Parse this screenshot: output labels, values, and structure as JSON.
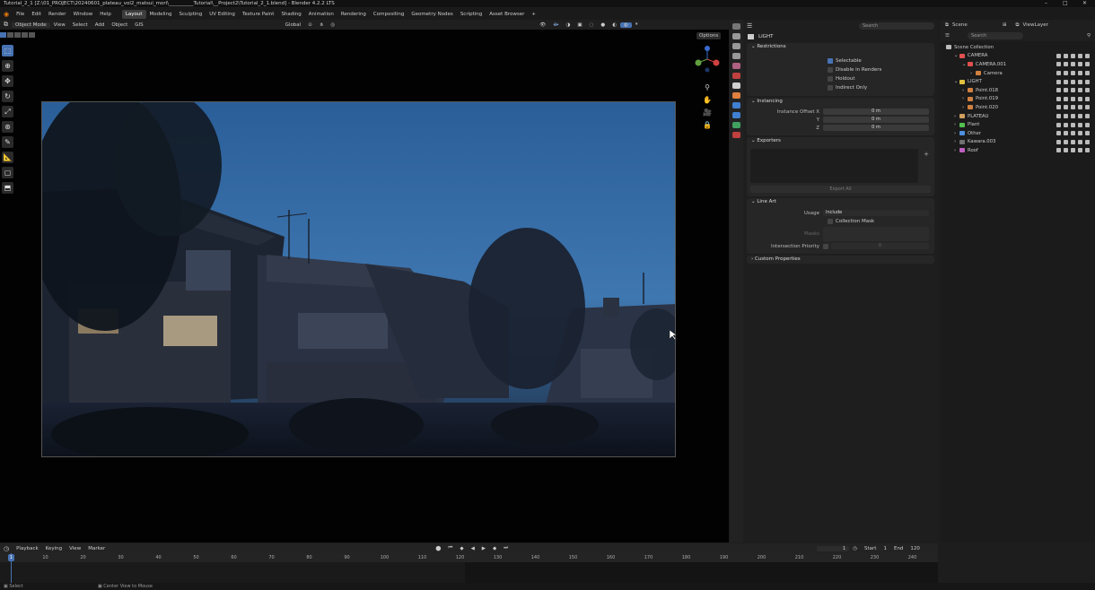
{
  "title_bar": {
    "title": "Tutorial_2_1 [Z:\\01_PROJECT\\20240601_plateau_vol2_matsui_mori\\__________Tutorial\\__Project2\\Tutorial_2_1.blend] - Blender 4.2.2 LTS",
    "controls": [
      "–",
      "□",
      "✕"
    ]
  },
  "menu": {
    "items": [
      "File",
      "Edit",
      "Render",
      "Window",
      "Help"
    ],
    "workspaces": [
      "Layout",
      "Modeling",
      "Sculpting",
      "UV Editing",
      "Texture Paint",
      "Shading",
      "Animation",
      "Rendering",
      "Compositing",
      "Geometry Nodes",
      "Scripting",
      "Asset Browser",
      "+"
    ],
    "active_workspace": "Layout"
  },
  "viewport_header": {
    "mode": "Object Mode",
    "menus": [
      "View",
      "Select",
      "Add",
      "Object"
    ],
    "gis": "GIS",
    "transform_orientation": "Global",
    "options": "Options"
  },
  "tools": [
    "select-icon",
    "cursor-icon",
    "move-icon",
    "rotate-icon",
    "scale-icon",
    "transform-icon",
    "annotate-icon",
    "measure-icon",
    "add-cube-icon",
    "extrude-icon"
  ],
  "properties": {
    "search_placeholder": "Search",
    "object_name": "LIGHT",
    "restrictions": {
      "title": "Restrictions",
      "items": [
        {
          "label": "Selectable",
          "checked": true
        },
        {
          "label": "Disable in Renders",
          "checked": false
        },
        {
          "label": "Holdout",
          "checked": false
        },
        {
          "label": "Indirect Only",
          "checked": false
        }
      ]
    },
    "instancing": {
      "title": "Instancing",
      "offset_x_label": "Instance Offset X",
      "y_label": "Y",
      "z_label": "Z",
      "offset_x": "0 m",
      "offset_y": "0 m",
      "offset_z": "0 m"
    },
    "exporters": {
      "title": "Exporters",
      "export_all": "Export All"
    },
    "line_art": {
      "title": "Line Art",
      "usage_label": "Usage",
      "usage_value": "Include",
      "collection_mask": "Collection Mask",
      "masks_label": "Masks",
      "intersection_priority_label": "Intersection Priority",
      "intersection_priority_value": "0"
    },
    "custom_properties": "Custom Properties"
  },
  "outliner": {
    "scene": "Scene",
    "view_layer": "ViewLayer",
    "search_placeholder": "Search",
    "root": "Scene Collection",
    "rows": [
      {
        "name": "CAMERA",
        "depth": 1,
        "color": "#e05050",
        "expanded": true
      },
      {
        "name": "CAMERA.001",
        "depth": 2,
        "color": "#e05050",
        "expanded": true
      },
      {
        "name": "Camera",
        "depth": 3,
        "color": "#d08040",
        "expanded": false
      },
      {
        "name": "LIGHT",
        "depth": 1,
        "color": "#e0c040",
        "expanded": true
      },
      {
        "name": "Point.018",
        "depth": 2,
        "color": "#d08040",
        "expanded": false
      },
      {
        "name": "Point.019",
        "depth": 2,
        "color": "#d08040",
        "expanded": false
      },
      {
        "name": "Point.020",
        "depth": 2,
        "color": "#d08040",
        "expanded": false
      },
      {
        "name": "PLATEAU",
        "depth": 1,
        "color": "#d0a060",
        "expanded": false
      },
      {
        "name": "Plant",
        "depth": 1,
        "color": "#50c050",
        "expanded": false
      },
      {
        "name": "Other",
        "depth": 1,
        "color": "#5090e0",
        "expanded": false
      },
      {
        "name": "Kawara.003",
        "depth": 1,
        "color": "#707070",
        "expanded": false
      },
      {
        "name": "Roof",
        "depth": 1,
        "color": "#c060c0",
        "expanded": false
      }
    ]
  },
  "timeline": {
    "menus": [
      "Playback",
      "Keying",
      "View",
      "Marker"
    ],
    "current_frame": "1",
    "start_label": "Start",
    "start": "1",
    "end_label": "End",
    "end": "120",
    "ticks": [
      "10",
      "20",
      "30",
      "40",
      "50",
      "60",
      "70",
      "80",
      "90",
      "100",
      "110",
      "120",
      "130",
      "140",
      "150",
      "160",
      "170",
      "180",
      "190",
      "200",
      "210",
      "220",
      "230",
      "240"
    ],
    "playhead": "1"
  },
  "status_bar": {
    "left": "Select",
    "middle": "Center View to Mouse"
  }
}
